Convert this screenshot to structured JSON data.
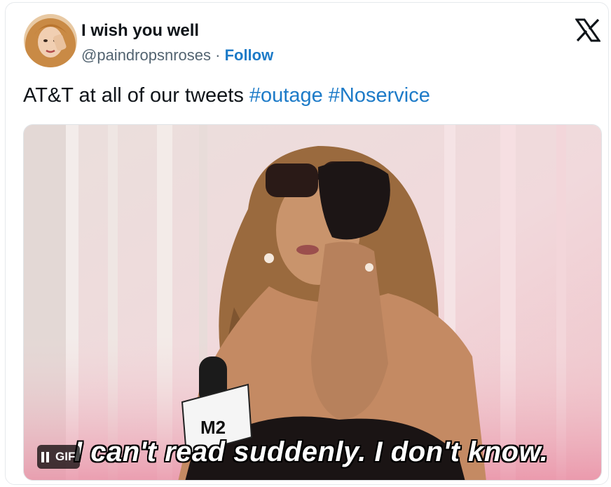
{
  "tweet": {
    "display_name": "I wish you well",
    "handle": "@paindropsnroses",
    "separator": " · ",
    "follow_label": "Follow",
    "text": "AT&T at all of our tweets ",
    "hashtags": [
      "#outage",
      "#Noservice"
    ]
  },
  "media": {
    "type_badge": "GIF",
    "subtitle": "I can't read suddenly. I don't know.",
    "mic_flag_text": "M2"
  },
  "icons": {
    "logo": "x-logo-icon",
    "pause": "pause-icon"
  },
  "colors": {
    "link": "#1d7bc8",
    "text": "#0f1419",
    "secondary": "#536471"
  }
}
